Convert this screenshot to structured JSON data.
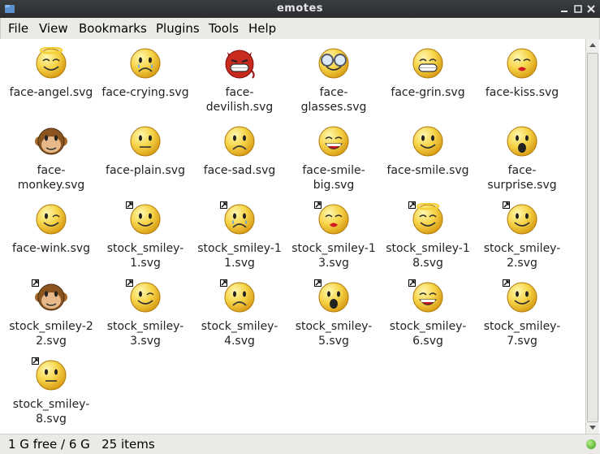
{
  "window": {
    "title": "emotes"
  },
  "menu": [
    "File",
    "View",
    "Bookmarks",
    "Plugins",
    "Tools",
    "Help"
  ],
  "files": [
    {
      "name": "face-angel.svg",
      "lines": [
        "face-angel.svg"
      ],
      "icon": "face-angel-icon",
      "link": false
    },
    {
      "name": "face-crying.svg",
      "lines": [
        "face-crying.svg"
      ],
      "icon": "face-crying-icon",
      "link": false
    },
    {
      "name": "face-devilish.svg",
      "lines": [
        "face-",
        "devilish.svg"
      ],
      "icon": "face-devilish-icon",
      "link": false
    },
    {
      "name": "face-glasses.svg",
      "lines": [
        "face-",
        "glasses.svg"
      ],
      "icon": "face-glasses-icon",
      "link": false
    },
    {
      "name": "face-grin.svg",
      "lines": [
        "face-grin.svg"
      ],
      "icon": "face-grin-icon",
      "link": false
    },
    {
      "name": "face-kiss.svg",
      "lines": [
        "face-kiss.svg"
      ],
      "icon": "face-kiss-icon",
      "link": false
    },
    {
      "name": "face-monkey.svg",
      "lines": [
        "face-",
        "monkey.svg"
      ],
      "icon": "face-monkey-icon",
      "link": false
    },
    {
      "name": "face-plain.svg",
      "lines": [
        "face-plain.svg"
      ],
      "icon": "face-plain-icon",
      "link": false
    },
    {
      "name": "face-sad.svg",
      "lines": [
        "face-sad.svg"
      ],
      "icon": "face-sad-icon",
      "link": false
    },
    {
      "name": "face-smile-big.svg",
      "lines": [
        "face-smile-",
        "big.svg"
      ],
      "icon": "face-smile-big-icon",
      "link": false
    },
    {
      "name": "face-smile.svg",
      "lines": [
        "face-smile.svg"
      ],
      "icon": "face-smile-icon",
      "link": false
    },
    {
      "name": "face-surprise.svg",
      "lines": [
        "face-",
        "surprise.svg"
      ],
      "icon": "face-surprise-icon",
      "link": false
    },
    {
      "name": "face-wink.svg",
      "lines": [
        "face-wink.svg"
      ],
      "icon": "face-wink-icon",
      "link": false
    },
    {
      "name": "stock_smiley-1.svg",
      "lines": [
        "stock_smiley-",
        "1.svg"
      ],
      "icon": "smiley-smile-icon",
      "link": true
    },
    {
      "name": "stock_smiley-11.svg",
      "lines": [
        "stock_smiley-1",
        "1.svg"
      ],
      "icon": "smiley-crying-icon",
      "link": true
    },
    {
      "name": "stock_smiley-13.svg",
      "lines": [
        "stock_smiley-1",
        "3.svg"
      ],
      "icon": "smiley-kiss-icon",
      "link": true
    },
    {
      "name": "stock_smiley-18.svg",
      "lines": [
        "stock_smiley-1",
        "8.svg"
      ],
      "icon": "smiley-angel-icon",
      "link": true
    },
    {
      "name": "stock_smiley-2.svg",
      "lines": [
        "stock_smiley-",
        "2.svg"
      ],
      "icon": "smiley-smile-icon",
      "link": true
    },
    {
      "name": "stock_smiley-22.svg",
      "lines": [
        "stock_smiley-2",
        "2.svg"
      ],
      "icon": "smiley-monkey-icon",
      "link": true
    },
    {
      "name": "stock_smiley-3.svg",
      "lines": [
        "stock_smiley-",
        "3.svg"
      ],
      "icon": "smiley-wink-icon",
      "link": true
    },
    {
      "name": "stock_smiley-4.svg",
      "lines": [
        "stock_smiley-",
        "4.svg"
      ],
      "icon": "smiley-sad-icon",
      "link": true
    },
    {
      "name": "stock_smiley-5.svg",
      "lines": [
        "stock_smiley-",
        "5.svg"
      ],
      "icon": "smiley-surprise-icon",
      "link": true
    },
    {
      "name": "stock_smiley-6.svg",
      "lines": [
        "stock_smiley-",
        "6.svg"
      ],
      "icon": "smiley-big-smile-icon",
      "link": true
    },
    {
      "name": "stock_smiley-7.svg",
      "lines": [
        "stock_smiley-",
        "7.svg"
      ],
      "icon": "smiley-smile-icon",
      "link": true
    },
    {
      "name": "stock_smiley-8.svg",
      "lines": [
        "stock_smiley-",
        "8.svg"
      ],
      "icon": "smiley-plain-icon",
      "link": true
    }
  ],
  "status": {
    "text": "1 G free / 6 G   25 items"
  }
}
